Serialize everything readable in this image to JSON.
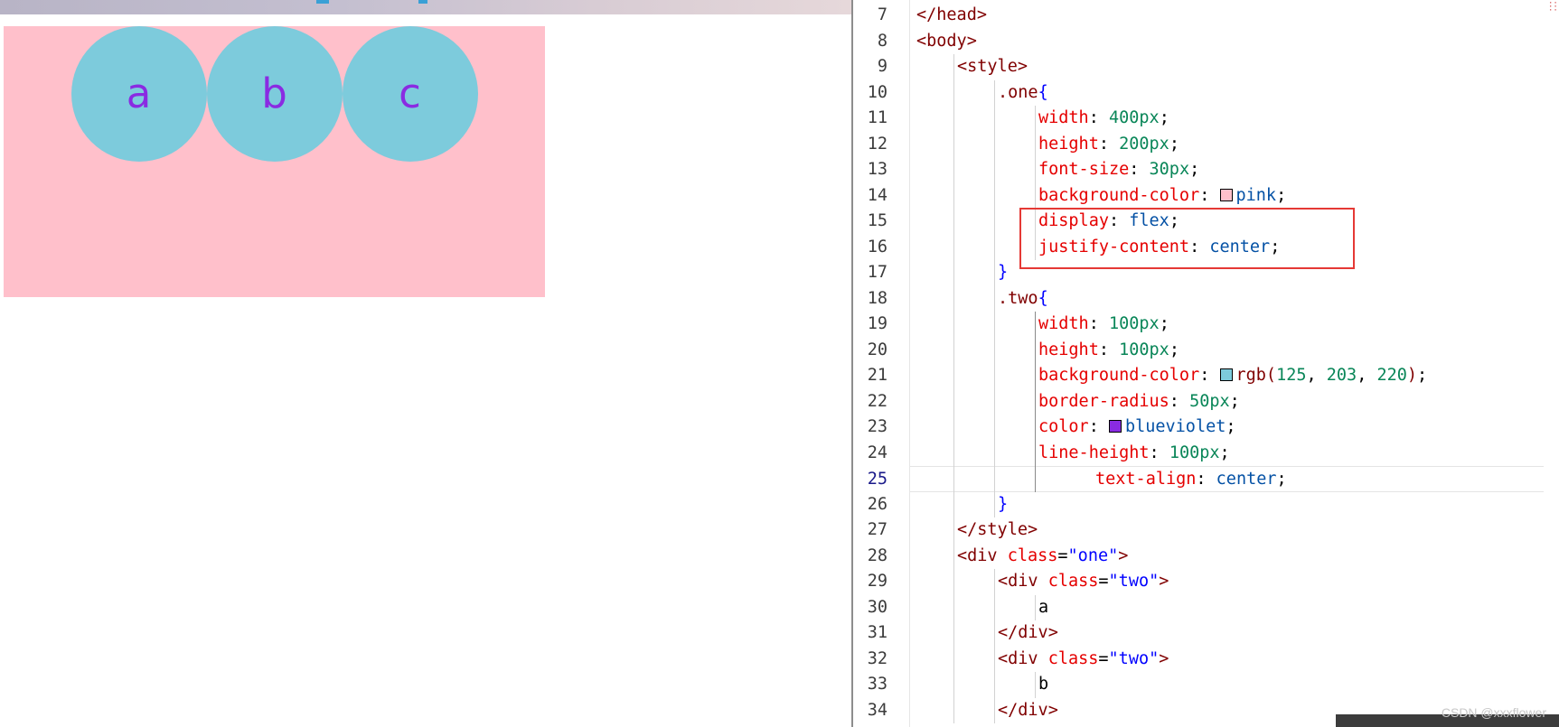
{
  "preview": {
    "items": [
      "a",
      "b",
      "c"
    ],
    "box_color": "#ffc0cb",
    "circle_color": "rgb(125, 203, 220)",
    "text_color": "blueviolet"
  },
  "editor": {
    "current_line": 25,
    "lines": [
      {
        "n": 7,
        "indent": 0,
        "tokens": [
          {
            "t": "tag",
            "v": "</head>"
          }
        ]
      },
      {
        "n": 8,
        "indent": 0,
        "tokens": [
          {
            "t": "tag",
            "v": "<body>"
          }
        ]
      },
      {
        "n": 9,
        "indent": 1,
        "tokens": [
          {
            "t": "tag",
            "v": "<style>"
          }
        ]
      },
      {
        "n": 10,
        "indent": 2,
        "tokens": [
          {
            "t": "sel",
            "v": ".one"
          },
          {
            "t": "brace",
            "v": "{"
          }
        ]
      },
      {
        "n": 11,
        "indent": 3,
        "tokens": [
          {
            "t": "prop",
            "v": "width"
          },
          {
            "t": "plain",
            "v": ": "
          },
          {
            "t": "num",
            "v": "400px"
          },
          {
            "t": "plain",
            "v": ";"
          }
        ]
      },
      {
        "n": 12,
        "indent": 3,
        "tokens": [
          {
            "t": "prop",
            "v": "height"
          },
          {
            "t": "plain",
            "v": ": "
          },
          {
            "t": "num",
            "v": "200px"
          },
          {
            "t": "plain",
            "v": ";"
          }
        ]
      },
      {
        "n": 13,
        "indent": 3,
        "tokens": [
          {
            "t": "prop",
            "v": "font-size"
          },
          {
            "t": "plain",
            "v": ": "
          },
          {
            "t": "num",
            "v": "30px"
          },
          {
            "t": "plain",
            "v": ";"
          }
        ]
      },
      {
        "n": 14,
        "indent": 3,
        "tokens": [
          {
            "t": "prop",
            "v": "background-color"
          },
          {
            "t": "plain",
            "v": ": "
          },
          {
            "t": "swatch",
            "v": "#ffc0cb"
          },
          {
            "t": "val",
            "v": "pink"
          },
          {
            "t": "plain",
            "v": ";"
          }
        ]
      },
      {
        "n": 15,
        "indent": 3,
        "tokens": [
          {
            "t": "prop",
            "v": "display"
          },
          {
            "t": "plain",
            "v": ": "
          },
          {
            "t": "val",
            "v": "flex"
          },
          {
            "t": "plain",
            "v": ";"
          }
        ]
      },
      {
        "n": 16,
        "indent": 3,
        "tokens": [
          {
            "t": "prop",
            "v": "justify-content"
          },
          {
            "t": "plain",
            "v": ": "
          },
          {
            "t": "val",
            "v": "center"
          },
          {
            "t": "plain",
            "v": ";"
          }
        ]
      },
      {
        "n": 17,
        "indent": 2,
        "tokens": [
          {
            "t": "brace",
            "v": "}"
          }
        ]
      },
      {
        "n": 18,
        "indent": 2,
        "tokens": [
          {
            "t": "sel",
            "v": ".two"
          },
          {
            "t": "brace",
            "v": "{"
          }
        ]
      },
      {
        "n": 19,
        "indent": 3,
        "tokens": [
          {
            "t": "prop",
            "v": "width"
          },
          {
            "t": "plain",
            "v": ": "
          },
          {
            "t": "num",
            "v": "100px"
          },
          {
            "t": "plain",
            "v": ";"
          }
        ]
      },
      {
        "n": 20,
        "indent": 3,
        "tokens": [
          {
            "t": "prop",
            "v": "height"
          },
          {
            "t": "plain",
            "v": ": "
          },
          {
            "t": "num",
            "v": "100px"
          },
          {
            "t": "plain",
            "v": ";"
          }
        ]
      },
      {
        "n": 21,
        "indent": 3,
        "tokens": [
          {
            "t": "prop",
            "v": "background-color"
          },
          {
            "t": "plain",
            "v": ": "
          },
          {
            "t": "swatch",
            "v": "#7dcbdc"
          },
          {
            "t": "sel",
            "v": "rgb("
          },
          {
            "t": "num",
            "v": "125"
          },
          {
            "t": "plain",
            "v": ", "
          },
          {
            "t": "num",
            "v": "203"
          },
          {
            "t": "plain",
            "v": ", "
          },
          {
            "t": "num",
            "v": "220"
          },
          {
            "t": "sel",
            "v": ")"
          },
          {
            "t": "plain",
            "v": ";"
          }
        ]
      },
      {
        "n": 22,
        "indent": 3,
        "tokens": [
          {
            "t": "prop",
            "v": "border-radius"
          },
          {
            "t": "plain",
            "v": ": "
          },
          {
            "t": "num",
            "v": "50px"
          },
          {
            "t": "plain",
            "v": ";"
          }
        ]
      },
      {
        "n": 23,
        "indent": 3,
        "tokens": [
          {
            "t": "prop",
            "v": "color"
          },
          {
            "t": "plain",
            "v": ": "
          },
          {
            "t": "swatch",
            "v": "#8a2be2"
          },
          {
            "t": "val",
            "v": "blueviolet"
          },
          {
            "t": "plain",
            "v": ";"
          }
        ]
      },
      {
        "n": 24,
        "indent": 3,
        "tokens": [
          {
            "t": "prop",
            "v": "line-height"
          },
          {
            "t": "plain",
            "v": ": "
          },
          {
            "t": "num",
            "v": "100px"
          },
          {
            "t": "plain",
            "v": ";"
          }
        ]
      },
      {
        "n": 25,
        "indent": 3,
        "tokens": [
          {
            "t": "prop",
            "v": "text-align"
          },
          {
            "t": "plain",
            "v": ": "
          },
          {
            "t": "val",
            "v": "center"
          },
          {
            "t": "plain",
            "v": ";"
          }
        ]
      },
      {
        "n": 26,
        "indent": 2,
        "tokens": [
          {
            "t": "brace",
            "v": "}"
          }
        ]
      },
      {
        "n": 27,
        "indent": 1,
        "tokens": [
          {
            "t": "tag",
            "v": "</style>"
          }
        ]
      },
      {
        "n": 28,
        "indent": 1,
        "tokens": [
          {
            "t": "tag",
            "v": "<div "
          },
          {
            "t": "attr",
            "v": "class"
          },
          {
            "t": "plain",
            "v": "="
          },
          {
            "t": "str",
            "v": "\"one\""
          },
          {
            "t": "tag",
            "v": ">"
          }
        ]
      },
      {
        "n": 29,
        "indent": 2,
        "tokens": [
          {
            "t": "tag",
            "v": "<div "
          },
          {
            "t": "attr",
            "v": "class"
          },
          {
            "t": "plain",
            "v": "="
          },
          {
            "t": "str",
            "v": "\"two\""
          },
          {
            "t": "tag",
            "v": ">"
          }
        ]
      },
      {
        "n": 30,
        "indent": 3,
        "tokens": [
          {
            "t": "plain",
            "v": "a"
          }
        ]
      },
      {
        "n": 31,
        "indent": 2,
        "tokens": [
          {
            "t": "tag",
            "v": "</div>"
          }
        ]
      },
      {
        "n": 32,
        "indent": 2,
        "tokens": [
          {
            "t": "tag",
            "v": "<div "
          },
          {
            "t": "attr",
            "v": "class"
          },
          {
            "t": "plain",
            "v": "="
          },
          {
            "t": "str",
            "v": "\"two\""
          },
          {
            "t": "tag",
            "v": ">"
          }
        ]
      },
      {
        "n": 33,
        "indent": 3,
        "tokens": [
          {
            "t": "plain",
            "v": "b"
          }
        ]
      },
      {
        "n": 34,
        "indent": 2,
        "tokens": [
          {
            "t": "tag",
            "v": "</div>"
          }
        ]
      }
    ]
  },
  "watermark": "CSDN @xxxflower"
}
